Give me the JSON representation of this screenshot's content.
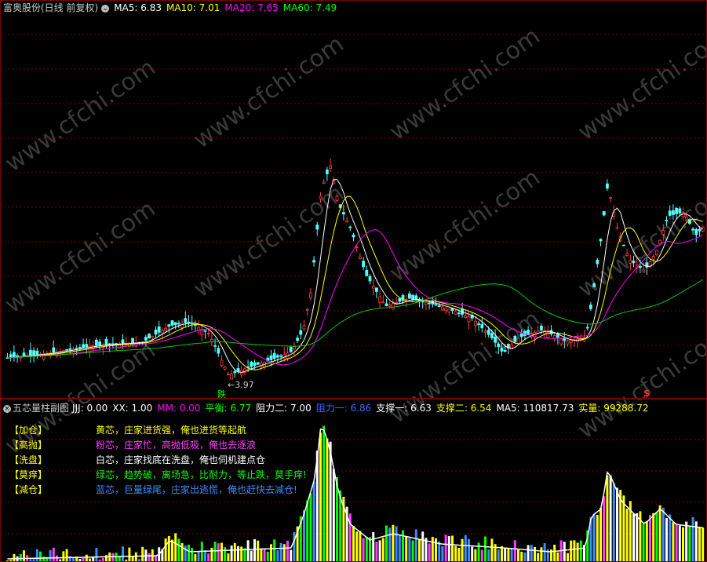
{
  "main_header": {
    "title": "富奥股份(日线 前复权)",
    "ma": [
      {
        "label": "MA5: 6.83",
        "color": "#ffffff"
      },
      {
        "label": "MA10: 7.01",
        "color": "#ffff00"
      },
      {
        "label": "MA20: 7.65",
        "color": "#ff00ff"
      },
      {
        "label": "MA60: 7.49",
        "color": "#00ff00"
      }
    ]
  },
  "annotations": {
    "low_price": "3.97",
    "fall_tag": "跌",
    "dollar_tag": "$"
  },
  "sub_header": {
    "title": "五芯量柱副图",
    "items": [
      {
        "label": "JJJ: 0.00",
        "color": "#ffffff"
      },
      {
        "label": "XX: 1.00",
        "color": "#ffffff"
      },
      {
        "label": "MM: 0.00",
        "color": "#ff00ff"
      },
      {
        "label": "平衡: 6.77",
        "color": "#00ff00"
      },
      {
        "label": "阻力二: 7.00",
        "color": "#ffffff"
      },
      {
        "label": "阻力一: 6.86",
        "color": "#3c64ff"
      },
      {
        "label": "支撑一: 6.63",
        "color": "#ffffff"
      },
      {
        "label": "支撑二: 6.54",
        "color": "#ffff00"
      },
      {
        "label": "MA5: 110817.73",
        "color": "#ffffff"
      },
      {
        "label": "实量: 99288.72",
        "color": "#ffff00"
      }
    ]
  },
  "legend": [
    {
      "key": "【加仓】",
      "text": "黄芯，庄家进货强，俺也进货等起航",
      "color": "#ffff00"
    },
    {
      "key": "【高抛】",
      "text": "粉芯，庄家忙，高抛低吸，俺也去逐浪",
      "color": "#ff40ff"
    },
    {
      "key": "【洗盘】",
      "text": "白芯，庄家找底在洗盘，俺也伺机建点仓",
      "color": "#ffffff"
    },
    {
      "key": "【莫痒】",
      "text": "绿芯，趋势破，离场急，比耐力，等止跌，莫手痒!",
      "color": "#00ff00"
    },
    {
      "key": "【减仓】",
      "text": "蓝芯，巨量绿尾，庄家出逃慌，俺也赶快去减仓!",
      "color": "#3c8cff"
    }
  ],
  "watermark": "www.cfchi.com",
  "colors": {
    "up": "#ff3c3c",
    "down": "#54ffff",
    "ma5": "#ffffff",
    "ma10": "#ffff00",
    "ma20": "#ff00ff",
    "ma60": "#00c800",
    "grid": "#7a0000"
  }
}
